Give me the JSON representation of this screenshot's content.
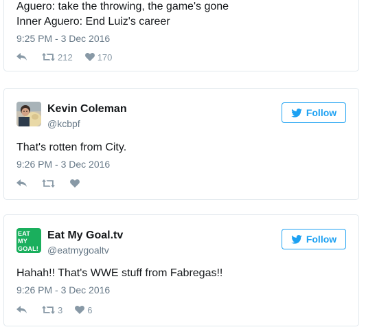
{
  "tweets": [
    {
      "text_lines": [
        "Aguero: take the throwing, the game's gone",
        "Inner Aguero: End Luiz's career"
      ],
      "timestamp": "9:25 PM - 3 Dec 2016",
      "retweets": "212",
      "likes": "170"
    },
    {
      "display_name": "Kevin Coleman",
      "handle": "@kcbpf",
      "follow_label": "Follow",
      "text": "That's rotten from City.",
      "timestamp": "9:26 PM - 3 Dec 2016",
      "retweets": "",
      "likes": ""
    },
    {
      "display_name": "Eat My Goal.tv",
      "handle": "@eatmygoaltv",
      "follow_label": "Follow",
      "avatar_logo_lines": [
        "EAT",
        "MY",
        "GOAL!"
      ],
      "text": "Hahah!! That's WWE stuff from Fabregas!!",
      "timestamp": "9:26 PM - 3 Dec 2016",
      "retweets": "3",
      "likes": "6"
    }
  ],
  "icons": {
    "reply": "reply-icon",
    "retweet": "retweet-icon",
    "like": "heart-icon",
    "follow": "twitter-bird-icon"
  },
  "colors": {
    "accent": "#1da1f2",
    "muted": "#8899a6",
    "text": "#14171a",
    "border": "#e1e8ed",
    "logo_green": "#1aaf5d"
  }
}
